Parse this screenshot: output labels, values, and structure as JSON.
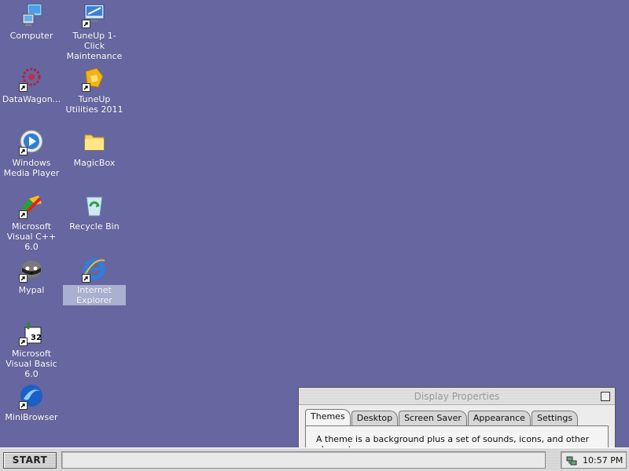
{
  "desktop": {
    "background": "#6666a0",
    "icons": [
      {
        "label": "Computer",
        "icon": "computer-icon",
        "shortcut": false
      },
      {
        "label": "TuneUp 1-Click Maintenance",
        "icon": "tuneup-maintenance-icon",
        "shortcut": true
      },
      {
        "label": "DataWagon...",
        "icon": "datawagon-icon",
        "shortcut": true
      },
      {
        "label": "TuneUp Utilities 2011",
        "icon": "tuneup-utilities-icon",
        "shortcut": true
      },
      {
        "label": "Windows Media Player",
        "icon": "media-player-icon",
        "shortcut": true
      },
      {
        "label": "MagicBox",
        "icon": "folder-icon",
        "shortcut": false
      },
      {
        "label": "Microsoft Visual C++ 6.0",
        "icon": "visual-cpp-icon",
        "shortcut": true
      },
      {
        "label": "Recycle Bin",
        "icon": "recycle-bin-icon",
        "shortcut": false
      },
      {
        "label": "Mypal",
        "icon": "mypal-icon",
        "shortcut": true
      },
      {
        "label": "Internet Explorer",
        "icon": "internet-explorer-icon",
        "shortcut": true,
        "selected": true
      },
      {
        "label": "Microsoft Visual Basic 6.0",
        "icon": "visual-basic-icon",
        "shortcut": true
      },
      {
        "label": "MiniBrowser",
        "icon": "minibrowser-icon",
        "shortcut": true
      }
    ]
  },
  "window": {
    "title": "Display Properties",
    "tabs": [
      "Themes",
      "Desktop",
      "Screen Saver",
      "Appearance",
      "Settings"
    ],
    "active_tab": "Themes",
    "description": "A theme is a background plus a set of sounds, icons, and other elements"
  },
  "taskbar": {
    "start_label": "START",
    "clock": "10:57 PM",
    "tray_icon": "network-icon"
  }
}
